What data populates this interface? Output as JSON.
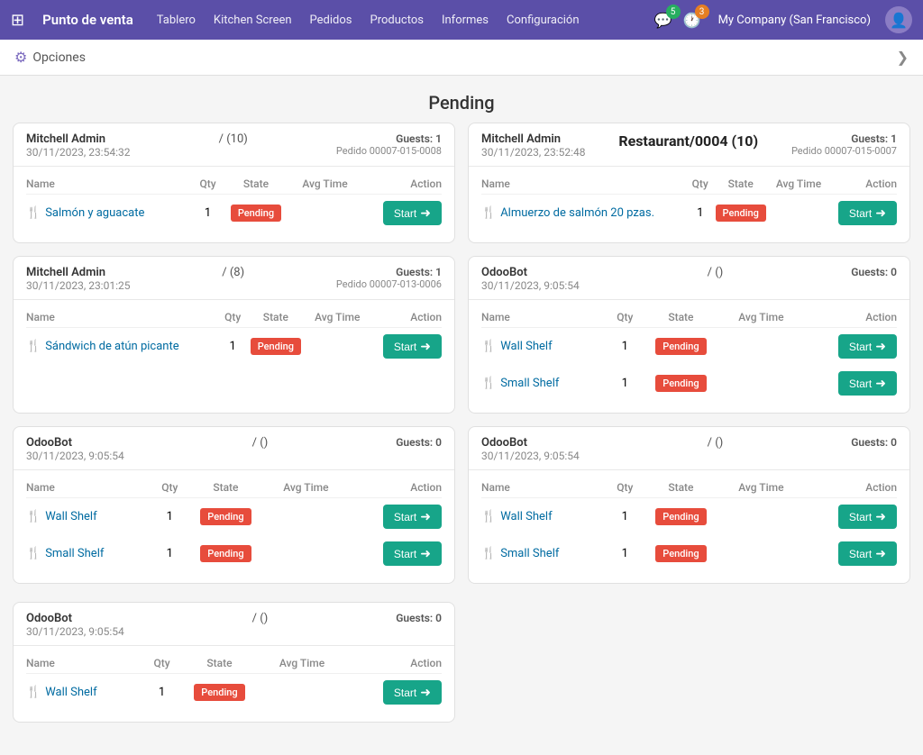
{
  "nav": {
    "app_label": "Punto de venta",
    "items": [
      "Tablero",
      "Kitchen Screen",
      "Pedidos",
      "Productos",
      "Informes",
      "Configuración"
    ],
    "chat_badge": "5",
    "clock_badge": "3",
    "company": "My Company (San Francisco)"
  },
  "options_bar": {
    "label": "Opciones",
    "chevron": "❯"
  },
  "page_title": "Pending",
  "columns": {
    "name": "Name",
    "qty": "Qty",
    "state": "State",
    "avg_time": "Avg Time",
    "action": "Action"
  },
  "cards": [
    {
      "admin": "Mitchell Admin",
      "date": "30/11/2023, 23:54:32",
      "table": "/ (10)",
      "guests": "Guests: 1",
      "order_id": "Pedido 00007-015-0008",
      "items": [
        {
          "name": "Salmón y aguacate",
          "qty": "1",
          "state": "Pending"
        }
      ]
    },
    {
      "admin": "Mitchell Admin",
      "date": "30/11/2023, 23:52:48",
      "table": "Restaurant/0004 (10)",
      "guests": "Guests: 1",
      "order_id": "Pedido 00007-015-0007",
      "items": [
        {
          "name": "Almuerzo de salmón 20 pzas.",
          "qty": "1",
          "state": "Pending"
        }
      ]
    },
    {
      "admin": "Mitchell Admin",
      "date": "30/11/2023, 23:01:25",
      "table": "/ (8)",
      "guests": "Guests: 1",
      "order_id": "Pedido 00007-013-0006",
      "items": [
        {
          "name": "Sándwich de atún picante",
          "qty": "1",
          "state": "Pending"
        }
      ]
    },
    {
      "admin": "OdooBot",
      "date": "30/11/2023, 9:05:54",
      "table": "/ ()",
      "guests": "Guests: 0",
      "order_id": "",
      "items": [
        {
          "name": "Wall Shelf",
          "qty": "1",
          "state": "Pending"
        },
        {
          "name": "Small Shelf",
          "qty": "1",
          "state": "Pending"
        }
      ]
    },
    {
      "admin": "OdooBot",
      "date": "30/11/2023, 9:05:54",
      "table": "/ ()",
      "guests": "Guests: 0",
      "order_id": "",
      "items": [
        {
          "name": "Wall Shelf",
          "qty": "1",
          "state": "Pending"
        },
        {
          "name": "Small Shelf",
          "qty": "1",
          "state": "Pending"
        }
      ]
    },
    {
      "admin": "OdooBot",
      "date": "30/11/2023, 9:05:54",
      "table": "/ ()",
      "guests": "Guests: 0",
      "order_id": "",
      "items": [
        {
          "name": "Wall Shelf",
          "qty": "1",
          "state": "Pending"
        },
        {
          "name": "Small Shelf",
          "qty": "1",
          "state": "Pending"
        }
      ]
    },
    {
      "admin": "OdooBot",
      "date": "30/11/2023, 9:05:54",
      "table": "/ ()",
      "guests": "Guests: 0",
      "order_id": "",
      "items": [
        {
          "name": "Wall Shelf",
          "qty": "1",
          "state": "Pending"
        }
      ]
    }
  ],
  "start_label": "Start",
  "pending_label": "Pending"
}
